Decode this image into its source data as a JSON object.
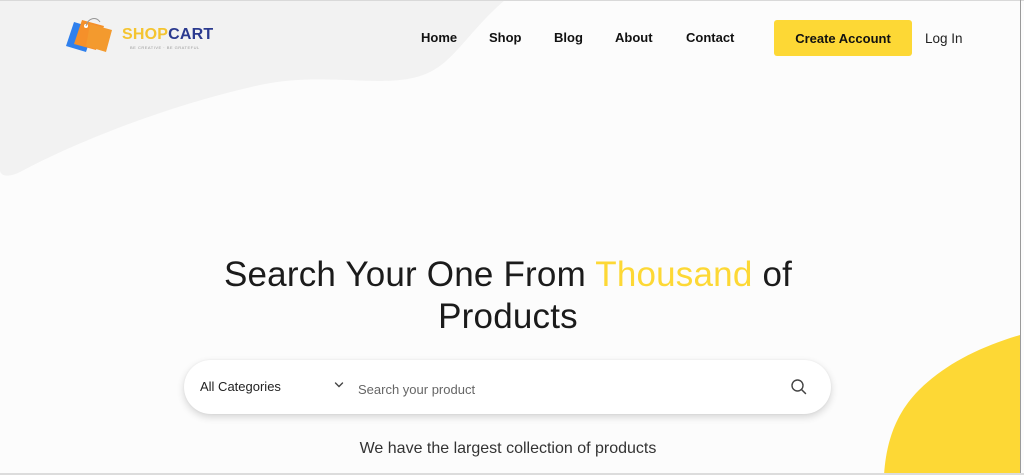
{
  "brand": {
    "name_part1": "SHOP",
    "name_part2": "CART",
    "tagline": "BE CREATIVE · BE GRATEFUL",
    "colors": {
      "yellow": "#fdd835",
      "navy": "#2b3a8f",
      "orange": "#f5902a",
      "blue": "#2f80ed"
    }
  },
  "nav": {
    "items": [
      {
        "label": "Home"
      },
      {
        "label": "Shop"
      },
      {
        "label": "Blog"
      },
      {
        "label": "About"
      },
      {
        "label": "Contact"
      }
    ],
    "create_account_label": "Create Account",
    "login_label": "Log In"
  },
  "hero": {
    "title_before": "Search Your One From ",
    "title_highlight": "Thousand",
    "title_after_line1": " of",
    "title_line2": "Products",
    "subtitle": "We have the largest collection of products"
  },
  "search": {
    "category_selected": "All Categories",
    "placeholder": "Search your product",
    "icons": {
      "dropdown": "chevron-down-icon",
      "submit": "search-icon"
    }
  }
}
